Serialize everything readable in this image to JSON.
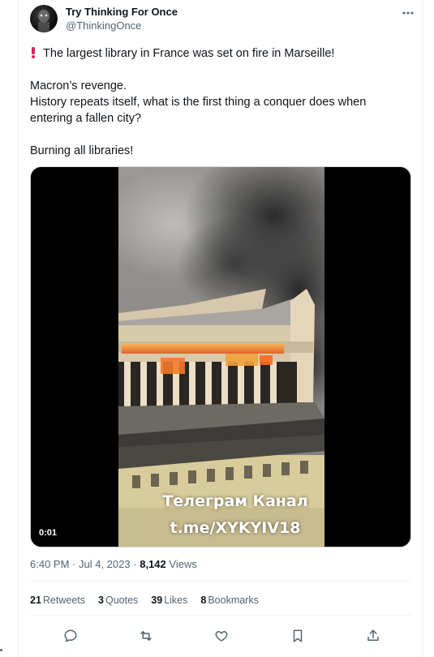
{
  "author": {
    "name": "Try Thinking For Once",
    "handle": "@ThinkingOnce"
  },
  "tweet": {
    "line1_icon": "exclamation-icon",
    "line1": "The largest library in France was set on fire in Marseille!",
    "line2": "Macron’s revenge.",
    "line3": "History repeats itself, what is the first thing a conquer does when",
    "line4": "entering a fallen city?",
    "line5": "Burning all libraries!"
  },
  "video": {
    "timecode": "0:01",
    "overlay_line1": "Телеграм Канал",
    "overlay_line2": "t.me/XYKYIV18"
  },
  "meta": {
    "time": "6:40 PM",
    "separator": "·",
    "date": "Jul 4, 2023",
    "views_count": "8,142",
    "views_label": "Views"
  },
  "stats": {
    "retweets_count": "21",
    "retweets_label": "Retweets",
    "quotes_count": "3",
    "quotes_label": "Quotes",
    "likes_count": "39",
    "likes_label": "Likes",
    "bookmarks_count": "8",
    "bookmarks_label": "Bookmarks"
  },
  "actions": [
    "reply-icon",
    "retweet-icon",
    "like-icon",
    "bookmark-icon",
    "share-icon"
  ],
  "colors": {
    "text_primary": "#0f1419",
    "text_secondary": "#536471",
    "border": "#eff3f4",
    "exclamation": "#e0245e"
  }
}
